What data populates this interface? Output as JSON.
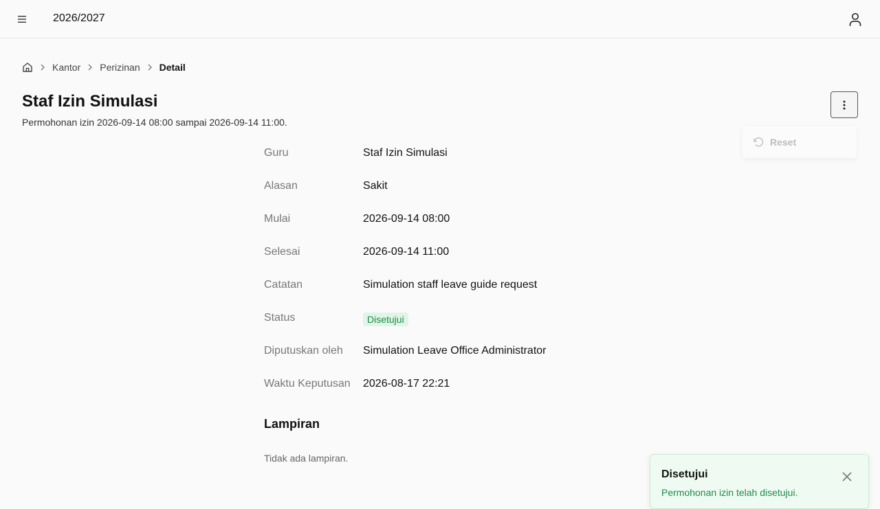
{
  "header": {
    "year": "2026/2027",
    "menu_icon": "hamburger-icon",
    "user_icon": "user-icon"
  },
  "breadcrumb": {
    "home_icon": "home-icon",
    "items": [
      "Kantor",
      "Perizinan"
    ],
    "current": "Detail"
  },
  "page": {
    "title": "Staf Izin Simulasi",
    "subtitle": "Permohonan izin 2026-09-14 08:00 sampai 2026-09-14 11:00."
  },
  "actions": {
    "more_icon": "more-vertical-icon",
    "menu": {
      "reset_label": "Reset",
      "reset_icon": "rotate-ccw-icon"
    }
  },
  "details": [
    {
      "label": "Guru",
      "value": "Staf Izin Simulasi"
    },
    {
      "label": "Alasan",
      "value": "Sakit"
    },
    {
      "label": "Mulai",
      "value": "2026-09-14 08:00"
    },
    {
      "label": "Selesai",
      "value": "2026-09-14 11:00"
    },
    {
      "label": "Catatan",
      "value": "Simulation staff leave guide request"
    },
    {
      "label": "Status",
      "value": "Disetujui"
    },
    {
      "label": "Diputuskan oleh",
      "value": "Simulation Leave Office Administrator"
    },
    {
      "label": "Waktu Keputusan",
      "value": "2026-08-17 22:21"
    }
  ],
  "attachments": {
    "title": "Lampiran",
    "empty": "Tidak ada lampiran."
  },
  "toast": {
    "title": "Disetujui",
    "message": "Permohonan izin telah disetujui.",
    "close_icon": "close-icon"
  },
  "colors": {
    "badge_bg": "#dff5e6",
    "badge_text": "#1e8a4a",
    "toast_bg": "#effbf2"
  }
}
